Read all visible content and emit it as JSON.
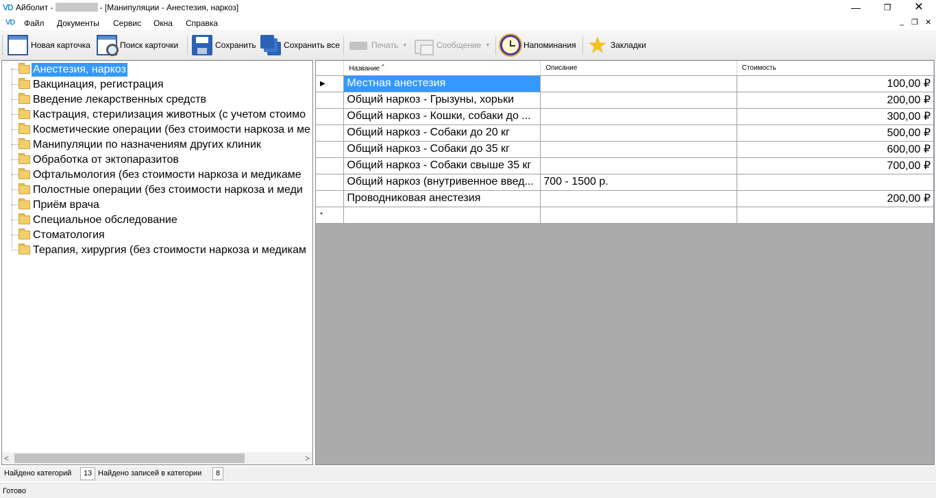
{
  "window": {
    "logo": "VD",
    "title_prefix": "Айболит -",
    "title_suffix": "- [Манипуляции - Анестезия, наркоз]",
    "minimize": "—",
    "maximize": "❐",
    "close": "✕"
  },
  "menu": {
    "logo": "VD",
    "items": [
      "Файл",
      "Документы",
      "Сервис",
      "Окна",
      "Справка"
    ],
    "mdi": {
      "minimize": "_",
      "restore": "❐",
      "close": "✕"
    }
  },
  "toolbar": {
    "new_card": "Новая карточка",
    "find_card": "Поиск карточки",
    "save": "Сохранить",
    "save_all": "Сохранить все",
    "print": "Печать",
    "message": "Сообщение",
    "reminders": "Напоминания",
    "bookmarks": "Закладки",
    "icons": {
      "new_card": "card-icon",
      "find_card": "card-search-icon",
      "save": "floppy-icon",
      "save_all": "floppies-icon",
      "print": "printer-icon",
      "message": "envelope-icon",
      "reminders": "alarm-clock-icon",
      "bookmarks": "star-icon"
    }
  },
  "tree": {
    "items": [
      "Анестезия, наркоз",
      "Вакцинация, регистрация",
      "Введение лекарственных средств",
      "Кастрация, стерилизация животных (с учетом стоимо",
      "Косметические операции (без стоимости наркоза и ме",
      "Манипуляции по назначениям других клиник",
      "Обработка от эктопаразитов",
      "Офтальмология (без стоимости наркоза и медикаме",
      "Полостные операции (без стоимости наркоза и меди",
      "Приём врача",
      "Специальное обследование",
      "Стоматология",
      "Терапия, хирургия (без стоимости наркоза и медикам"
    ],
    "selected_index": 0,
    "scroll_left": "<",
    "scroll_right": ">"
  },
  "grid": {
    "columns": [
      "Название",
      "Описание",
      "Стоимость"
    ],
    "sort_indicator": "^",
    "current_row_marker": "▶",
    "new_row_marker": "*",
    "rows": [
      {
        "name": "Местная анестезия",
        "description": "",
        "cost": "100,00 ₽"
      },
      {
        "name": "Общий наркоз - Грызуны, хорьки",
        "description": "",
        "cost": "200,00 ₽"
      },
      {
        "name": "Общий наркоз - Кошки, собаки до ...",
        "description": "",
        "cost": "300,00 ₽"
      },
      {
        "name": "Общий наркоз - Собаки до 20 кг",
        "description": "",
        "cost": "500,00 ₽"
      },
      {
        "name": "Общий наркоз - Собаки до 35 кг",
        "description": "",
        "cost": "600,00 ₽"
      },
      {
        "name": "Общий наркоз - Собаки свыше 35 кг",
        "description": "",
        "cost": "700,00 ₽"
      },
      {
        "name": "Общий наркоз (внутривенное введ...",
        "description": "700 - 1500 р.",
        "cost": ""
      },
      {
        "name": "Проводниковая анестезия",
        "description": "",
        "cost": "200,00 ₽"
      }
    ]
  },
  "counts": {
    "categories_label": "Найдено категорий",
    "categories_value": "13",
    "records_label": "Найдено записей в категории",
    "records_value": "8"
  },
  "status": {
    "text": "Готово"
  }
}
